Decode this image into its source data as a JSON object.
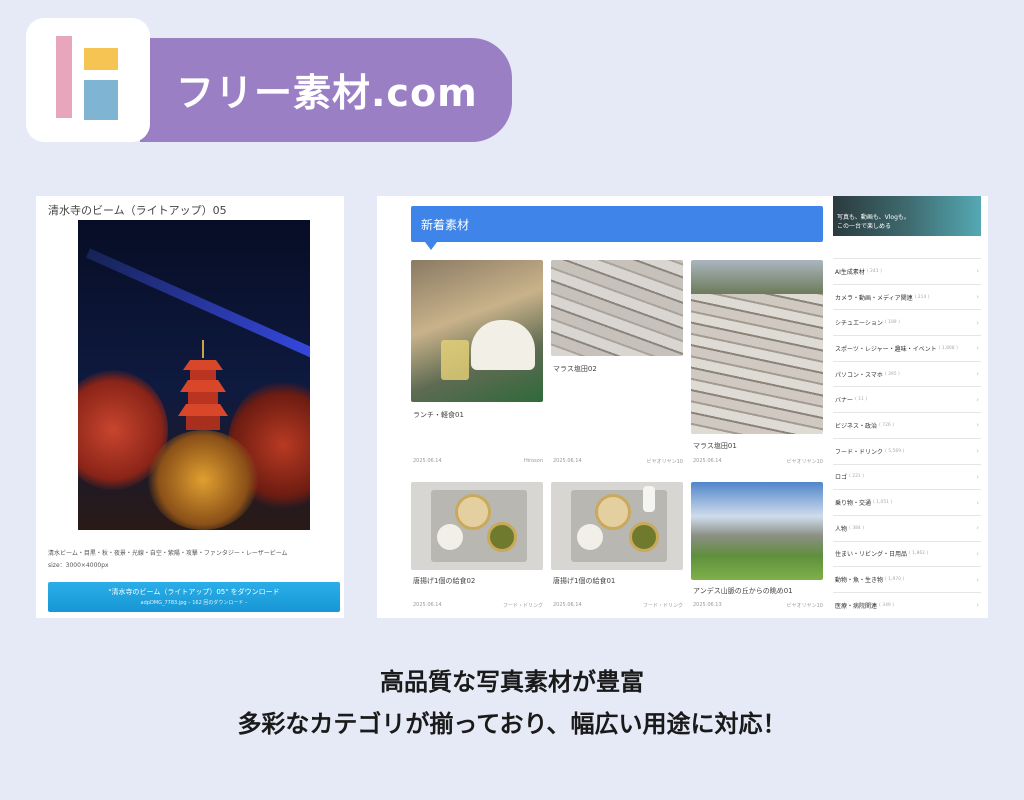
{
  "brand": {
    "site_name": "フリー素材.com",
    "colors": {
      "pill": "#9b7fc4",
      "logo_pink": "#e8a6bd",
      "logo_yellow": "#f6c453",
      "logo_blue": "#7fb5d3"
    }
  },
  "detail_page": {
    "title": "清水寺のビーム（ライトアップ）05",
    "tags": "清水ビーム・目黒・秋・夜景・光線・自空・紫陽・攻撃・ファンタジー・レーザービーム",
    "size": "size：3000×4000px",
    "download_label": "\"清水寺のビーム（ライトアップ）05\" をダウンロード",
    "download_sub": "adpDMG_7783.jpg – 162 回のダウンロード –"
  },
  "new_materials": {
    "heading": "新着素材",
    "cards": [
      {
        "title": "ランチ・軽食01",
        "date": "2025.06.14",
        "author": "Hiroson"
      },
      {
        "title": "マラス塩田02",
        "date": "2025.06.14",
        "author": "ビヤオリヤン10"
      },
      {
        "title": "マラス塩田01",
        "date": "2025.06.14",
        "author": "ビヤオリヤン10"
      },
      {
        "title": "唐揚げ1個の給食02",
        "date": "2025.06.14",
        "author": "フード・ドリンク"
      },
      {
        "title": "唐揚げ1個の給食01",
        "date": "2025.06.14",
        "author": "フード・ドリンク"
      },
      {
        "title": "アンデス山脈の丘からの眺め01",
        "date": "2025.06.13",
        "author": "ビヤオリヤン10"
      }
    ]
  },
  "sidebar": {
    "ad_text_line1": "写真も、動画も、Vlogも。",
    "ad_text_line2": "この一台で楽しめる",
    "categories": [
      {
        "label": "AI生成素材",
        "count": "( 241 )"
      },
      {
        "label": "カメラ・動画・メディア関連",
        "count": "( 214 )"
      },
      {
        "label": "シチュエーション",
        "count": "( 189 )"
      },
      {
        "label": "スポーツ・レジャー・趣味・イベント",
        "count": "( 1,808 )"
      },
      {
        "label": "パソコン・スマホ",
        "count": "( 395 )"
      },
      {
        "label": "バナー",
        "count": "( 11 )"
      },
      {
        "label": "ビジネス・政治",
        "count": "( 726 )"
      },
      {
        "label": "フード・ドリンク",
        "count": "( 5,569 )"
      },
      {
        "label": "ロゴ",
        "count": "( 221 )"
      },
      {
        "label": "乗り物・交通",
        "count": "( 1,051 )"
      },
      {
        "label": "人物",
        "count": "( 384 )"
      },
      {
        "label": "住まい・リビング・日用品",
        "count": "( 1,862 )"
      },
      {
        "label": "動物・魚・生き物",
        "count": "( 1,970 )"
      },
      {
        "label": "医療・病院関連",
        "count": "( 349 )"
      }
    ]
  },
  "captions": {
    "line1": "高品質な写真素材が豊富",
    "line2": "多彩なカテゴリが揃っており、幅広い用途に対応！"
  }
}
